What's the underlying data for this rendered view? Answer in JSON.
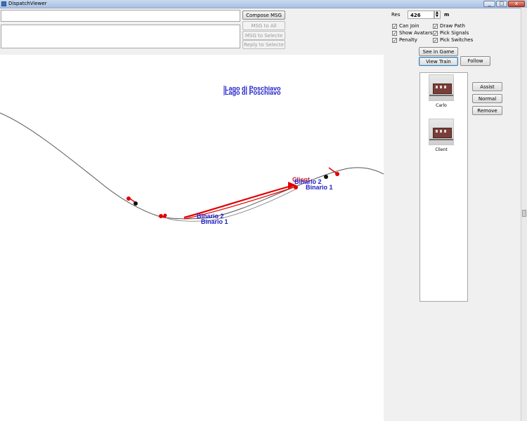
{
  "window": {
    "title": "DispatchViewer",
    "min": "_",
    "max": "□",
    "close": "x"
  },
  "messaging": {
    "compose": "Compose MSG",
    "msg_to_all": "MSG to All",
    "msg_to_selected": "MSG to Selecte",
    "reply_to_selected": "Reply to Selecte"
  },
  "res": {
    "label": "Res",
    "value": "426",
    "unit": "m"
  },
  "options": {
    "can_join": "Can Join",
    "show_avatars": "Show Avatars",
    "penalty": "Penalty",
    "draw_path": "Draw Path",
    "pick_signals": "Pick Signals",
    "pick_switches": "Pick Switches"
  },
  "view": {
    "see_in_game": "See in Game",
    "view_train": "View Train",
    "follow": "Follow"
  },
  "avatar_actions": {
    "assist": "Assist",
    "normal": "Normal",
    "remove": "Remove"
  },
  "avatars": [
    {
      "name": "Carlo"
    },
    {
      "name": "Client"
    }
  ],
  "map": {
    "station": "Lago di Poschiavo",
    "binario1": "Binario 1",
    "binario2": "Binario 2",
    "client": "Client",
    "colors": {
      "track": "#555555",
      "path": "#e00000",
      "label": "#1c1cc8",
      "train": "#cc1a2a"
    }
  }
}
